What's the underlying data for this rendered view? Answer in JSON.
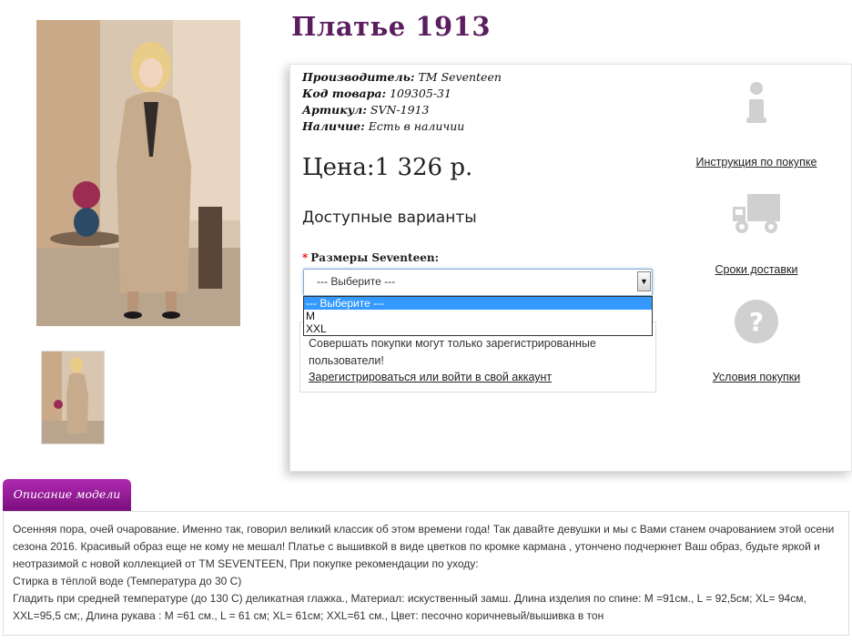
{
  "product": {
    "title": "Платье 1913",
    "manufacturer_label": "Производитель:",
    "manufacturer": "TM Seventeen",
    "code_label": "Код товара:",
    "code": "109305-31",
    "article_label": "Артикул:",
    "article": "SVN-1913",
    "availability_label": "Наличие:",
    "availability": "Есть в наличии",
    "price": "Цена:1 326 р."
  },
  "options": {
    "heading": "Доступные варианты",
    "size_label": "Размеры Seventeen:",
    "select_value": "--- Выберите ---",
    "items": [
      "--- Выберите ---",
      "M",
      "XXL"
    ]
  },
  "notice": {
    "text": "Совершать покупки могут только зарегистрированные пользователи!",
    "link": "Зарегистрироваться или войти в свой аккаунт"
  },
  "sidebar": {
    "instructions": "Инструкция по покупке",
    "delivery": "Сроки доставки",
    "terms": "Условия покупки"
  },
  "description": {
    "tab": "Описание модели",
    "text": "Осенняя пора, очей очарование. Именно так, говорил великий классик об этом времени года! Так давайте девушки и мы с Вами станем очарованием этой осени сезона 2016. Красивый образ еще не кому не мешал! Платье с вышивкой в виде цветков по кромке кармана , утончено подчеркнет Ваш образ, будьте яркой и неотразимой с новой коллекцией от TM SEVENTEEN, При покупке рекомендации по уходу:",
    "care1": "Стирка в тёплой воде (Температура до 30 С)",
    "care2": "Гладить при средней температуре (до 130 С) деликатная глажка., Материал: искуственный замш. Длина изделия по спине: M =91см., L = 92,5см; XL= 94см, XXL=95,5 см;, Длина рукава : M =61 см., L = 61 см; XL= 61см; XXL=61 см., Цвет: песочно коричневый/вышивка в тон"
  },
  "colors": {
    "title": "#5a1d5f",
    "tab": "#9b1b9e",
    "select_highlight": "#3399ff"
  }
}
